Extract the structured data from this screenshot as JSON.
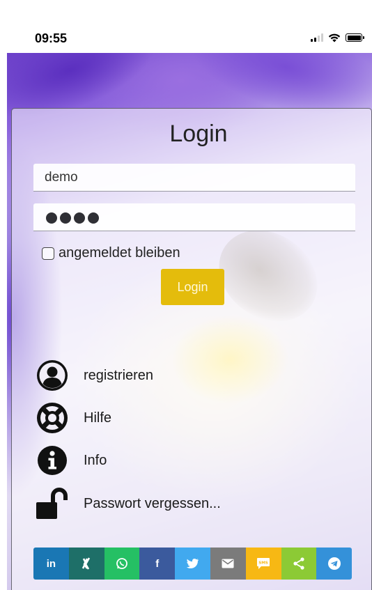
{
  "status": {
    "time": "09:55",
    "icons": [
      "signal-icon",
      "wifi-icon",
      "battery-icon"
    ]
  },
  "login": {
    "title": "Login",
    "username_value": "demo",
    "password_dots": 4,
    "remember_label": "angemeldet bleiben",
    "remember_checked": false,
    "button_label": "Login",
    "button_color": "#e4bc0c"
  },
  "menu": [
    {
      "icon": "user-circle-icon",
      "label": "registrieren"
    },
    {
      "icon": "life-ring-icon",
      "label": "Hilfe"
    },
    {
      "icon": "info-circle-icon",
      "label": "Info"
    },
    {
      "icon": "unlock-icon",
      "label": "Passwort vergessen..."
    }
  ],
  "share": [
    {
      "name": "linkedin",
      "label": "in",
      "color": "#1a77b4"
    },
    {
      "name": "xing",
      "label": "X",
      "color": "#1e6f68"
    },
    {
      "name": "whatsapp",
      "label": "",
      "color": "#25c064"
    },
    {
      "name": "facebook",
      "label": "f",
      "color": "#3b5a9d"
    },
    {
      "name": "twitter",
      "label": "",
      "color": "#41a9ef"
    },
    {
      "name": "email",
      "label": "",
      "color": "#7b7b7b"
    },
    {
      "name": "sms",
      "label": "SMS",
      "color": "#f7b814"
    },
    {
      "name": "share",
      "label": "",
      "color": "#8cca35"
    },
    {
      "name": "telegram",
      "label": "",
      "color": "#3491d9"
    }
  ]
}
